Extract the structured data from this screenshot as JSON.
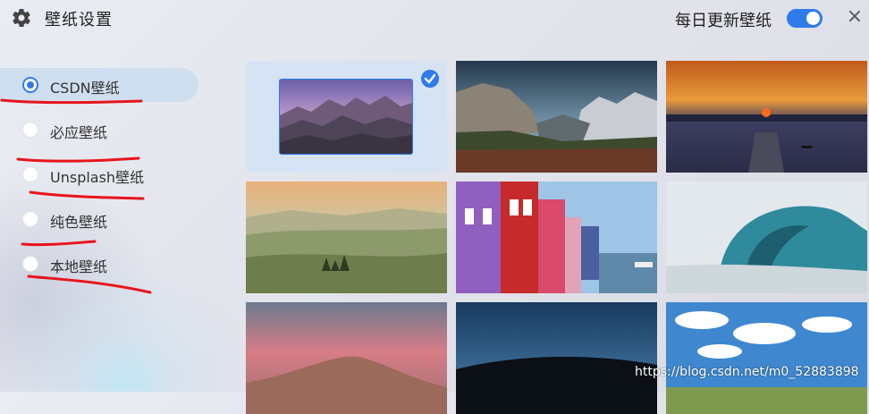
{
  "header": {
    "title": "壁纸设置",
    "daily_update_label": "每日更新壁纸",
    "daily_update_enabled": true,
    "close_symbol": "×"
  },
  "sources": [
    {
      "label": "CSDN壁纸",
      "selected": true
    },
    {
      "label": "必应壁纸",
      "selected": false
    },
    {
      "label": "Unsplash壁纸",
      "selected": false
    },
    {
      "label": "纯色壁纸",
      "selected": false
    },
    {
      "label": "本地壁纸",
      "selected": false
    }
  ],
  "wallpapers": [
    {
      "subject": "purple mountain range",
      "selected": true
    },
    {
      "subject": "mountain valley with waterfall",
      "selected": false
    },
    {
      "subject": "sunset over lake with pier",
      "selected": false
    },
    {
      "subject": "misty green hills",
      "selected": false
    },
    {
      "subject": "colorful canal houses",
      "selected": false
    },
    {
      "subject": "ocean wave",
      "selected": false
    },
    {
      "subject": "pink sky over hill",
      "selected": false
    },
    {
      "subject": "silhouette hill at dusk",
      "selected": false
    },
    {
      "subject": "blue sky with clouds",
      "selected": false
    }
  ],
  "watermark": "https://blog.csdn.net/m0_52883898",
  "colors": {
    "accent": "#2f7bea",
    "annotation": "#e8141b"
  }
}
